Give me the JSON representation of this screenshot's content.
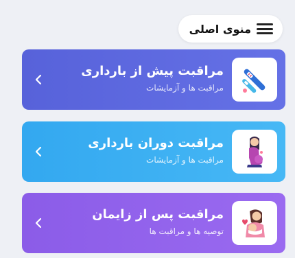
{
  "menu": {
    "label": "منوی اصلی",
    "icon": "hamburger-menu-icon"
  },
  "cards": [
    {
      "title": "مراقبت پیش از بارداری",
      "subtitle": "مراقبت ها و آزمایشات",
      "icon": "pregnancy-test-icon",
      "color": "#5d68de"
    },
    {
      "title": "مراقبت دوران بارداری",
      "subtitle": "مراقبت ها و آزمایشات",
      "icon": "pregnant-woman-icon",
      "color": "#3eb0f2"
    },
    {
      "title": "مراقبت پس از زایمان",
      "subtitle": "توصیه ها و مراقبت ها",
      "icon": "mother-baby-icon",
      "color": "#9163ec"
    }
  ]
}
